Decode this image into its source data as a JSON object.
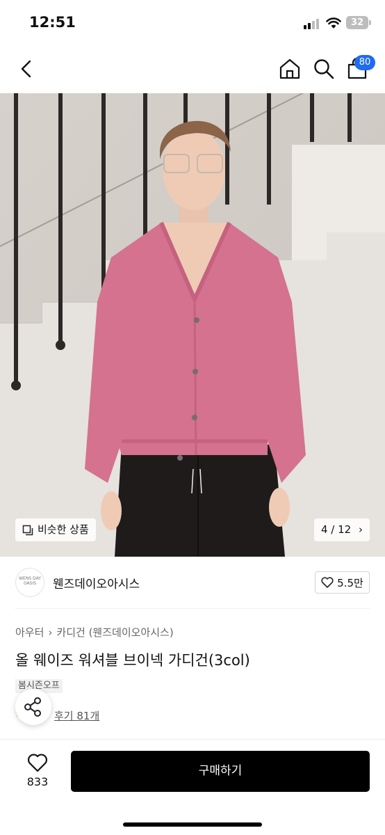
{
  "status": {
    "time": "12:51",
    "battery": "32"
  },
  "nav": {
    "cart_count": "80"
  },
  "gallery": {
    "similar_label": "비슷한 상품",
    "counter": "4 / 12"
  },
  "brand": {
    "logo_text": "WENS DAY OASIS",
    "name": "웬즈데이오아시스",
    "likes": "5.5만"
  },
  "product": {
    "breadcrumb": [
      "아우터",
      "카디건 (웬즈데이오아시스)"
    ],
    "title": "올 웨이즈 워셔블 브이넥 가디건(3col)",
    "tag": "봄시즌오프",
    "review_label": "후기 81개"
  },
  "bottom": {
    "wish_count": "833",
    "buy_label": "구매하기"
  },
  "colors": {
    "accent": "#1e6cf0",
    "cardigan": "#d4728f",
    "buy_button": "#000000"
  }
}
